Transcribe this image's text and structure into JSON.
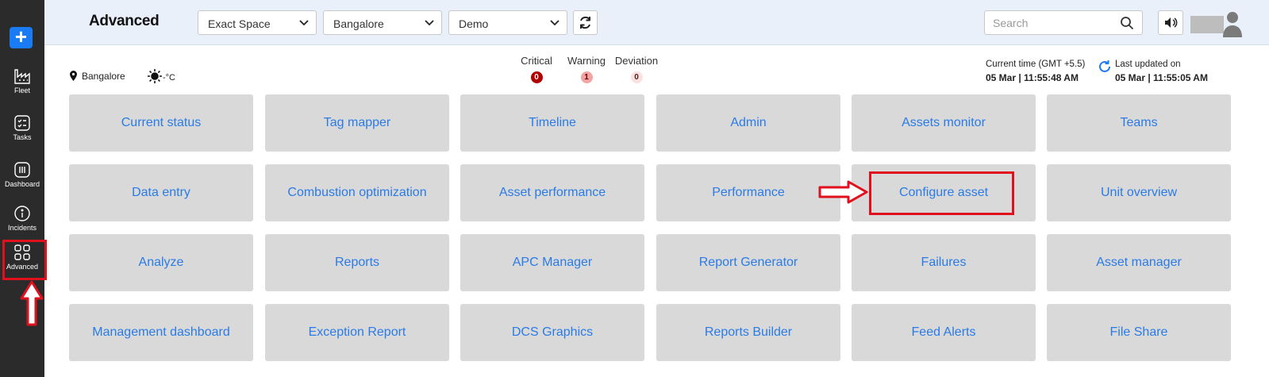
{
  "sidebar": {
    "add_label": "+",
    "items": [
      {
        "label": "Fleet",
        "icon": "factory-icon"
      },
      {
        "label": "Tasks",
        "icon": "checklist-icon"
      },
      {
        "label": "Dashboard",
        "icon": "bar-chart-icon"
      },
      {
        "label": "Incidents",
        "icon": "info-icon"
      },
      {
        "label": "Advanced",
        "icon": "grid-icon"
      }
    ]
  },
  "header": {
    "title": "Advanced",
    "dropdowns": [
      "Exact Space",
      "Bangalore",
      "Demo"
    ],
    "search_placeholder": "Search"
  },
  "info": {
    "location": "Bangalore",
    "temperature": "-°C",
    "alerts": [
      {
        "label": "Critical",
        "count": "0"
      },
      {
        "label": "Warning",
        "count": "1"
      },
      {
        "label": "Deviation",
        "count": "0"
      }
    ],
    "current_time_label": "Current time (GMT +5.5)",
    "current_time_value": "05 Mar | 11:55:48 AM",
    "last_updated_label": "Last updated on",
    "last_updated_value": "05 Mar | 11:55:05 AM"
  },
  "tiles": [
    [
      "Current status",
      "Tag mapper",
      "Timeline",
      "Admin",
      "Assets monitor",
      "Teams"
    ],
    [
      "Data entry",
      "Combustion optimization",
      "Asset performance",
      "Performance",
      "Configure asset",
      "Unit overview"
    ],
    [
      "Analyze",
      "Reports",
      "APC Manager",
      "Report Generator",
      "Failures",
      "Asset manager"
    ],
    [
      "Management dashboard",
      "Exception Report",
      "DCS Graphics",
      "Reports Builder",
      "Feed Alerts",
      "File Share"
    ]
  ],
  "colors": {
    "accent": "#1a7cf5",
    "tile_text": "#2a7be6",
    "highlight": "#e0101c",
    "sidebar_bg": "#2b2b2b",
    "header_bg": "#e9f0fa"
  }
}
